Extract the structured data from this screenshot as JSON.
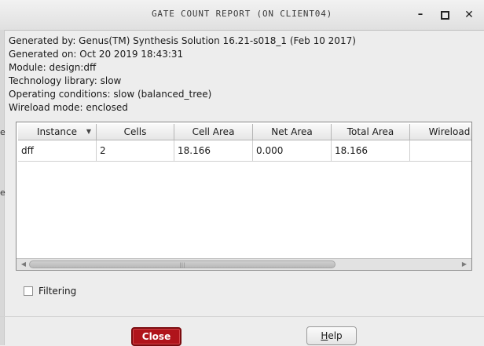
{
  "window": {
    "title": "GATE COUNT REPORT (ON CLIENT04)",
    "min_glyph": "–",
    "close_glyph": "✕"
  },
  "left_edge_glyphs": [
    "e",
    "e"
  ],
  "info": {
    "generated_by": "Generated by: Genus(TM) Synthesis Solution 16.21-s018_1 (Feb 10 2017)",
    "generated_on": "Generated on: Oct 20 2019 18:43:31",
    "module": "Module: design:dff",
    "technology_library": "Technology library: slow",
    "operating_conditions": "Operating conditions: slow (balanced_tree)",
    "wireload_mode": "Wireload mode: enclosed"
  },
  "table": {
    "columns": [
      "Instance",
      "Cells",
      "Cell Area",
      "Net Area",
      "Total Area",
      "Wireload"
    ],
    "sort_glyph": "▼",
    "rows": [
      [
        "dff",
        "2",
        "18.166",
        "0.000",
        "18.166",
        ""
      ]
    ],
    "scroll_left_glyph": "◀",
    "scroll_right_glyph": "▶",
    "scroll_grip": "|||"
  },
  "filtering": {
    "label": "Filtering",
    "checked": false
  },
  "buttons": {
    "close_label": "Close",
    "help_first": "H",
    "help_rest": "elp"
  },
  "colors": {
    "close_button": "#b0141b"
  }
}
